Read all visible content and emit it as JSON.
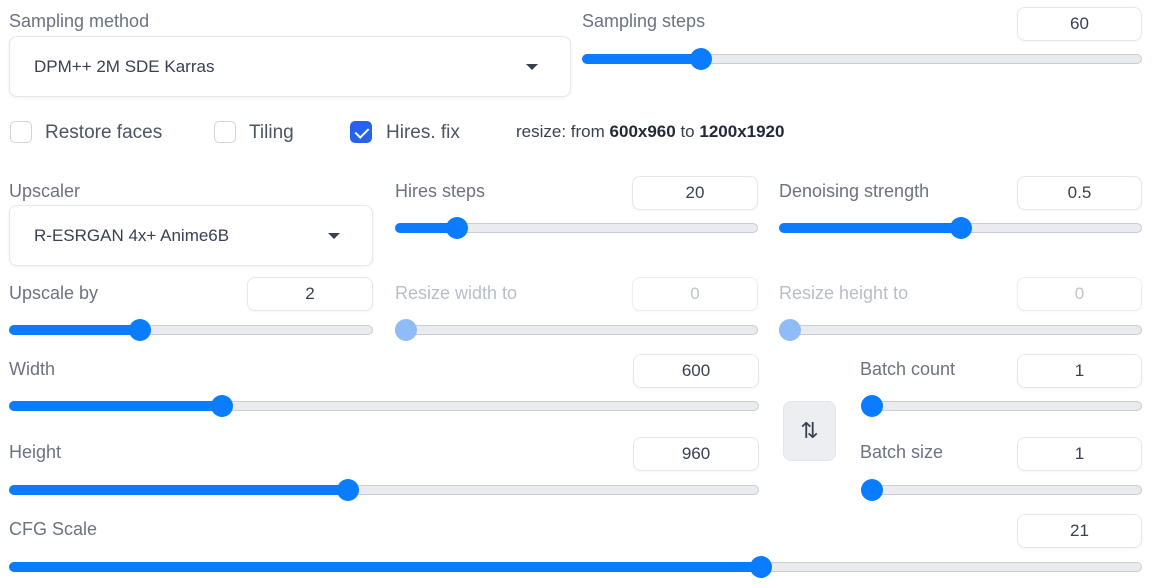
{
  "sampling_method": {
    "label": "Sampling method",
    "value": "DPM++ 2M SDE Karras"
  },
  "sampling_steps": {
    "label": "Sampling steps",
    "value": "60",
    "fraction": 0.2
  },
  "checkboxes": {
    "restore_faces": {
      "label": "Restore faces",
      "checked": false
    },
    "tiling": {
      "label": "Tiling",
      "checked": false
    },
    "hires_fix": {
      "label": "Hires. fix",
      "checked": true
    }
  },
  "resize_info": {
    "prefix": "resize: from",
    "from": "600x960",
    "to_word": "to",
    "to": "1200x1920"
  },
  "upscaler": {
    "label": "Upscaler",
    "value": "R-ESRGAN 4x+ Anime6B"
  },
  "hires_steps": {
    "label": "Hires steps",
    "value": "20",
    "fraction": 0.15
  },
  "denoising_strength": {
    "label": "Denoising strength",
    "value": "0.5",
    "fraction": 0.5
  },
  "upscale_by": {
    "label": "Upscale by",
    "value": "2",
    "fraction": 0.35
  },
  "resize_width": {
    "label": "Resize width to",
    "value": "0",
    "fraction": 0.0,
    "disabled": true
  },
  "resize_height": {
    "label": "Resize height to",
    "value": "0",
    "fraction": 0.0,
    "disabled": true
  },
  "width": {
    "label": "Width",
    "value": "600",
    "fraction": 0.278
  },
  "height": {
    "label": "Height",
    "value": "960",
    "fraction": 0.45
  },
  "batch_count": {
    "label": "Batch count",
    "value": "1",
    "fraction": 0.0
  },
  "batch_size": {
    "label": "Batch size",
    "value": "1",
    "fraction": 0.0
  },
  "swap_button": {
    "icon": "swap-vertical-icon",
    "glyph": "⇅"
  },
  "cfg_scale": {
    "label": "CFG Scale",
    "value": "21",
    "fraction": 0.667
  },
  "colors": {
    "accent": "#0a7cff",
    "checkbox": "#2563eb"
  }
}
